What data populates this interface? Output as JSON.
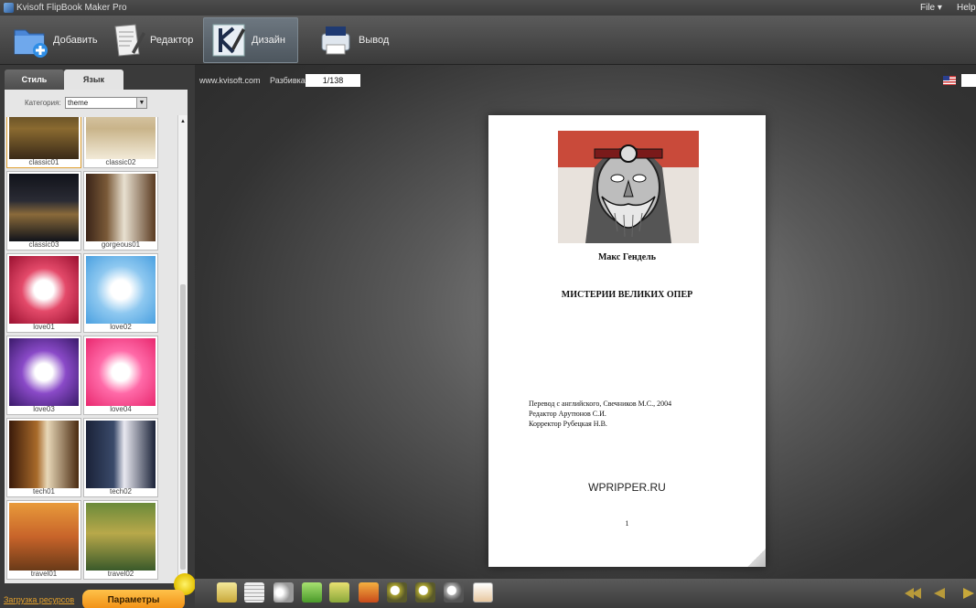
{
  "titlebar": {
    "title": "Kvisoft FlipBook Maker Pro",
    "menu": [
      "File",
      "Help"
    ],
    "file_arrow": "▾"
  },
  "toolbar": {
    "buttons": [
      {
        "label": "Добавить",
        "icon": "folder-add-icon"
      },
      {
        "label": "Редактор",
        "icon": "document-edit-icon"
      },
      {
        "label": "Дизайн",
        "icon": "design-brush-icon",
        "active": true
      },
      {
        "label": "Вывод",
        "icon": "printer-output-icon"
      }
    ]
  },
  "left_panel": {
    "tabs": [
      "Стиль",
      "Язык"
    ],
    "category_label": "Категория:",
    "category_value": "theme",
    "themes": [
      "classic01",
      "classic02",
      "classic03",
      "gorgeous01",
      "love01",
      "love02",
      "love03",
      "love04",
      "tech01",
      "tech02",
      "travel01",
      "travel02"
    ],
    "load_link": "Загрузка ресурсов",
    "params_button": "Параметры"
  },
  "viewer": {
    "site": "www.kvisoft.com",
    "page_label": "Разбивка:",
    "page_value": "1/138"
  },
  "page": {
    "author": "Макс Гендель",
    "title": "МИСТЕРИИ ВЕЛИКИХ ОПЕР",
    "credits": [
      "Перевод с английского, Свечников М.С., 2004",
      "Редактор Арутюнов С.И.",
      "Корректор Рубецкая Н.В."
    ],
    "watermark": "WPRIPPER.RU",
    "number": "1"
  },
  "bottom_toolbar": {
    "icons": [
      "book-icon",
      "page-list-icon",
      "sound-icon",
      "share-icon",
      "print-icon",
      "photo-icon",
      "zoom-in-icon",
      "zoom-out-icon",
      "search-icon",
      "fullscreen-icon"
    ],
    "nav": [
      "first-page-icon",
      "prev-page-icon",
      "next-page-icon"
    ]
  },
  "colors": {
    "accent_orange": "#f5a623",
    "stage": "#555555",
    "active_tab": "#5d666e"
  }
}
